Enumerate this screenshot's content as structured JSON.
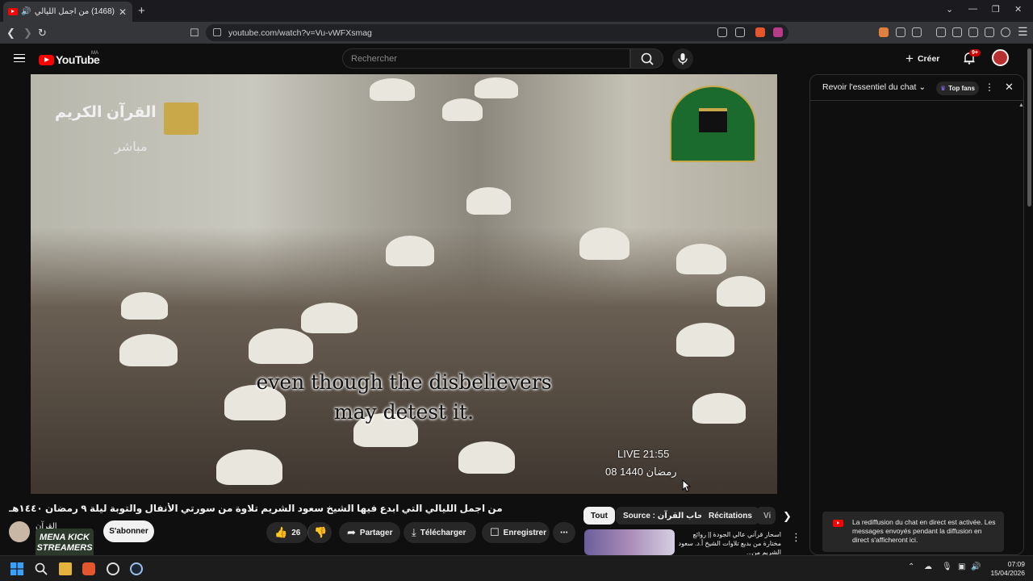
{
  "browser": {
    "tab_title": "(1468) من اجمل الليالي التي ا...",
    "url": "youtube.com/watch?v=Vu-vWFXsmag"
  },
  "header": {
    "logo_text": "YouTube",
    "country_code": "MA",
    "search_placeholder": "Rechercher",
    "create_label": "Créer",
    "notif_count": "9+"
  },
  "video": {
    "overlay_logo": "القرآن الكريم",
    "overlay_live": "مباشر",
    "subtitle_line1": "even though the disbelievers",
    "subtitle_line2": "may detest it.",
    "live_time": "LIVE 21:55",
    "hijri_date": "08 رمضان 1440",
    "title": "من اجمل الليالي التي ابدع فيها الشيخ سعود الشريم تلاوة من سورتي الأنفال والتوبة ليلة ٩ رمضان ١٤٤٠هـ"
  },
  "channel": {
    "name": "القرآن",
    "subscribe_label": "S'abonner",
    "overlay_text": "MENA KICK STREAMERS"
  },
  "actions": {
    "like_count": "26",
    "share_label": "Partager",
    "download_label": "Télécharger",
    "save_label": "Enregistrer"
  },
  "chips": {
    "all": "Tout",
    "source": "Source : في رحاب القرآن",
    "recitations": "Récitations",
    "more": "Vi"
  },
  "related": {
    "title": "اسحار قرآني عالي الجودة || روائع مختارة من بديع تلاوات الشيخ أ.د. سعود الشريم من..."
  },
  "chat": {
    "header": "Revoir l'essentiel du chat",
    "top_fans_label": "Top fans",
    "notice": "La rediffusion du chat en direct est activée. Les messages envoyés pendant la diffusion en direct s'afficheront ici."
  },
  "taskbar": {
    "time": "07:09",
    "date": "15/04/2026"
  }
}
